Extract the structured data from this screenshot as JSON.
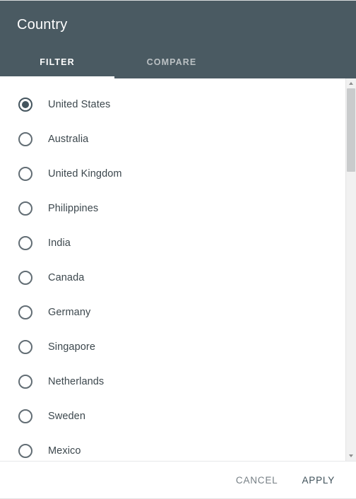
{
  "dialog": {
    "title": "Country"
  },
  "tabs": [
    {
      "label": "FILTER",
      "active": true
    },
    {
      "label": "COMPARE",
      "active": false
    }
  ],
  "options": [
    {
      "label": "United States",
      "selected": true
    },
    {
      "label": "Australia",
      "selected": false
    },
    {
      "label": "United Kingdom",
      "selected": false
    },
    {
      "label": "Philippines",
      "selected": false
    },
    {
      "label": "India",
      "selected": false
    },
    {
      "label": "Canada",
      "selected": false
    },
    {
      "label": "Germany",
      "selected": false
    },
    {
      "label": "Singapore",
      "selected": false
    },
    {
      "label": "Netherlands",
      "selected": false
    },
    {
      "label": "Sweden",
      "selected": false
    },
    {
      "label": "Mexico",
      "selected": false
    }
  ],
  "scrollbar": {
    "up_arrow_icon": "chevron-up-icon",
    "down_arrow_icon": "chevron-down-icon"
  },
  "footer": {
    "cancel_label": "CANCEL",
    "apply_label": "APPLY"
  },
  "colors": {
    "header_background": "#4a5a62",
    "accent": "#44555e",
    "option_text": "#3c474d",
    "cancel_text": "#767f85",
    "apply_text": "#3e5059",
    "scrollbar_track": "#f1f1f1",
    "scrollbar_thumb": "#c9cbcc"
  }
}
